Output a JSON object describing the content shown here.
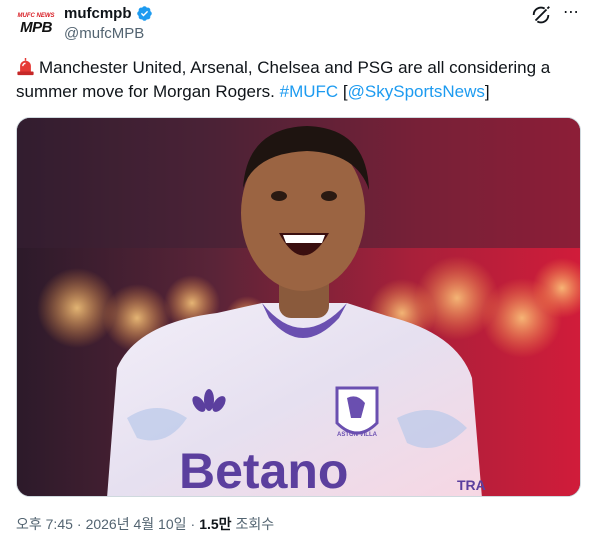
{
  "author": {
    "display_name": "mufcmpb",
    "handle": "@mufcMPB",
    "avatar_text_small": "MUFC NEWS",
    "avatar_text_big": "MPB",
    "verified": true
  },
  "tweet": {
    "emoji": "siren-icon",
    "text_main": "Manchester United, Arsenal, Chelsea and PSG are all considering a summer move for Morgan Rogers.",
    "hashtag": "#MUFC",
    "bracket_open": "[",
    "mention": "@SkySportsNews",
    "bracket_close": "]"
  },
  "media": {
    "jersey_sponsor": "Betano",
    "crest_text": "ASTON VILLA",
    "sleeve_text": "TRA"
  },
  "meta": {
    "time": "오후 7:45",
    "sep1": "·",
    "date": "2026년 4월 10일",
    "sep2": "·",
    "views_count": "1.5만",
    "views_label": "조회수"
  },
  "colors": {
    "link": "#1d9bf0",
    "verified": "#1d9bf0",
    "text_primary": "#0f1419",
    "text_secondary": "#536471"
  }
}
